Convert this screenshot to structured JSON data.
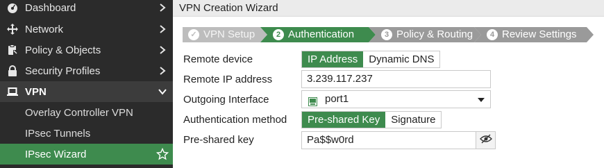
{
  "sidebar": {
    "items": [
      {
        "label": "Dashboard",
        "icon": "dashboard-icon"
      },
      {
        "label": "Network",
        "icon": "network-move-icon"
      },
      {
        "label": "Policy & Objects",
        "icon": "clipboard-icon"
      },
      {
        "label": "Security Profiles",
        "icon": "lock-icon"
      },
      {
        "label": "VPN",
        "icon": "laptop-icon"
      }
    ],
    "vpn_subitems": [
      {
        "label": "Overlay Controller VPN"
      },
      {
        "label": "IPsec Tunnels"
      },
      {
        "label": "IPsec Wizard",
        "active": true
      }
    ]
  },
  "main": {
    "title": "VPN Creation Wizard",
    "steps": [
      {
        "label": "VPN Setup",
        "marker": "✓",
        "state": "done"
      },
      {
        "label": "Authentication",
        "marker": "2",
        "state": "active"
      },
      {
        "label": "Policy & Routing",
        "marker": "3",
        "state": "todo"
      },
      {
        "label": "Review Settings",
        "marker": "4",
        "state": "todo"
      }
    ],
    "form": {
      "remote_device": {
        "label": "Remote device",
        "options": [
          "IP Address",
          "Dynamic DNS"
        ],
        "selected": "IP Address"
      },
      "remote_ip": {
        "label": "Remote IP address",
        "value": "3.239.117.237"
      },
      "outgoing_interface": {
        "label": "Outgoing Interface",
        "value": "port1"
      },
      "auth_method": {
        "label": "Authentication method",
        "options": [
          "Pre-shared Key",
          "Signature"
        ],
        "selected": "Pre-shared Key"
      },
      "psk": {
        "label": "Pre-shared key",
        "value": "Pa$$w0rd"
      }
    }
  },
  "colors": {
    "accent": "#3e8b4e",
    "sidebar_bg": "#2b2b2b",
    "step_done": "#bdbdbd",
    "step_todo": "#9a9a9a"
  }
}
